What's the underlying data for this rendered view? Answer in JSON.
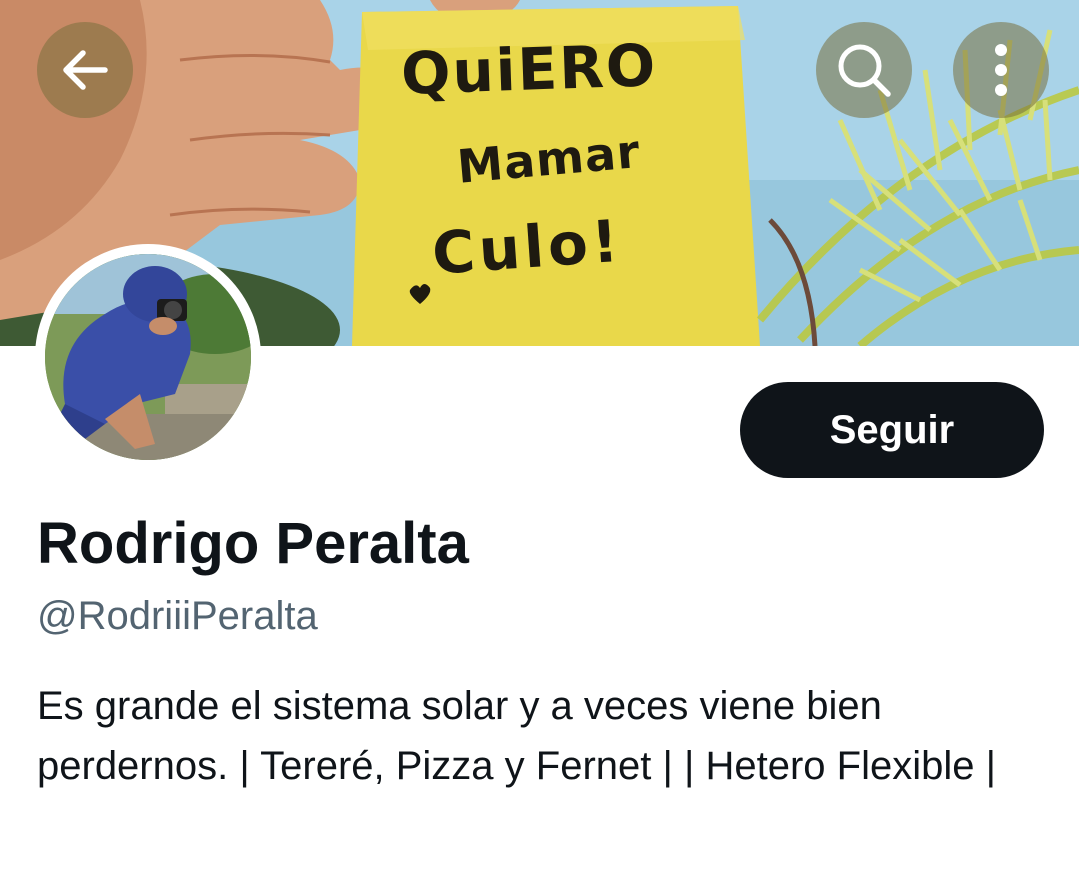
{
  "header": {
    "back_icon": "arrow-left-icon",
    "search_icon": "search-icon",
    "more_icon": "more-vertical-icon"
  },
  "banner": {
    "note_lines": [
      "QuiERO",
      "Mamar",
      "Culo!"
    ],
    "note_color": "#e9d84a"
  },
  "profile": {
    "display_name": "Rodrigo Peralta",
    "handle": "@RodriiiPeralta",
    "bio": "Es grande el sistema solar y a veces viene bien perdernos. | Tereré, Pizza y Fernet | | Hetero Flexible |",
    "follow_label": "Seguir"
  },
  "colors": {
    "follow_button_bg": "#0f1419",
    "handle_text": "#536471",
    "primary_text": "#0f1419"
  }
}
